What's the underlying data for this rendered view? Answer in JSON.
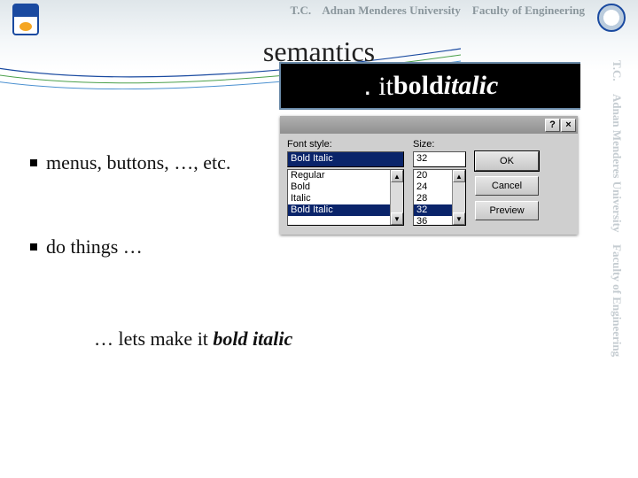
{
  "header": {
    "tc": "T.C.",
    "university": "Adnan Menderes University",
    "faculty": "Faculty of Engineering"
  },
  "title": "semantics",
  "bullets": {
    "b1": "menus, buttons, …, etc.",
    "b2": "do things …"
  },
  "tagline": {
    "prefix": "…  lets make it ",
    "bolditalic": "bold italic"
  },
  "strip": {
    "lead": "․ it ",
    "bold": "bold ",
    "bolditalic": "italic"
  },
  "dialog": {
    "help": "?",
    "close": "×",
    "font_style_label": "Font style:",
    "size_label": "Size:",
    "font_style_value": "Bold Italic",
    "size_value": "32",
    "styles": [
      "Regular",
      "Bold",
      "Italic",
      "Bold Italic"
    ],
    "style_selected": "Bold Italic",
    "sizes": [
      "20",
      "24",
      "28",
      "32",
      "36"
    ],
    "size_selected": "32",
    "ok": "OK",
    "cancel": "Cancel",
    "preview": "Preview"
  },
  "side": {
    "tc": "T.C.",
    "university": "Adnan Menderes University",
    "faculty": "Faculty of Engineering"
  }
}
